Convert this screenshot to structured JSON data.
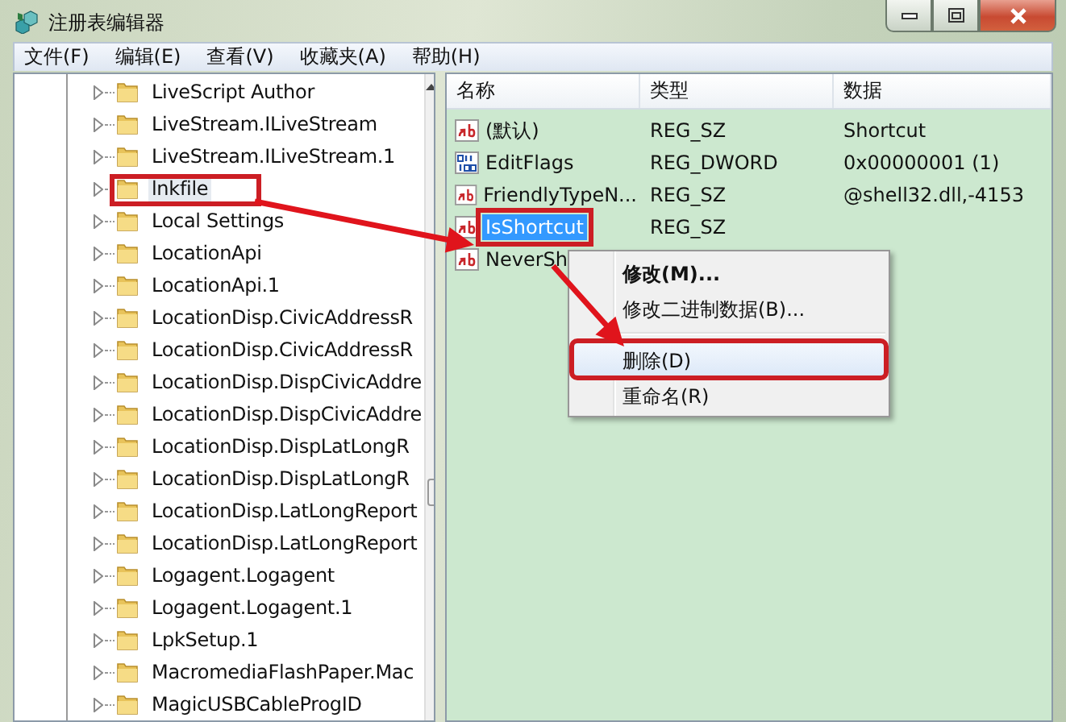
{
  "window": {
    "title": "注册表编辑器"
  },
  "menu": [
    "文件(F)",
    "编辑(E)",
    "查看(V)",
    "收藏夹(A)",
    "帮助(H)"
  ],
  "tree": {
    "items": [
      {
        "label": "LiveScript Author",
        "selected": false,
        "annotated": false
      },
      {
        "label": "LiveStream.ILiveStream",
        "selected": false,
        "annotated": false
      },
      {
        "label": "LiveStream.ILiveStream.1",
        "selected": false,
        "annotated": false
      },
      {
        "label": "lnkfile",
        "selected": true,
        "annotated": true
      },
      {
        "label": "Local Settings",
        "selected": false,
        "annotated": false
      },
      {
        "label": "LocationApi",
        "selected": false,
        "annotated": false
      },
      {
        "label": "LocationApi.1",
        "selected": false,
        "annotated": false
      },
      {
        "label": "LocationDisp.CivicAddressR",
        "selected": false,
        "annotated": false
      },
      {
        "label": "LocationDisp.CivicAddressR",
        "selected": false,
        "annotated": false
      },
      {
        "label": "LocationDisp.DispCivicAddre",
        "selected": false,
        "annotated": false
      },
      {
        "label": "LocationDisp.DispCivicAddre",
        "selected": false,
        "annotated": false
      },
      {
        "label": "LocationDisp.DispLatLongR",
        "selected": false,
        "annotated": false
      },
      {
        "label": "LocationDisp.DispLatLongR",
        "selected": false,
        "annotated": false
      },
      {
        "label": "LocationDisp.LatLongReport",
        "selected": false,
        "annotated": false
      },
      {
        "label": "LocationDisp.LatLongReport",
        "selected": false,
        "annotated": false
      },
      {
        "label": "Logagent.Logagent",
        "selected": false,
        "annotated": false
      },
      {
        "label": "Logagent.Logagent.1",
        "selected": false,
        "annotated": false
      },
      {
        "label": "LpkSetup.1",
        "selected": false,
        "annotated": false
      },
      {
        "label": "MacromediaFlashPaper.Mac",
        "selected": false,
        "annotated": false
      },
      {
        "label": "MagicUSBCableProgID",
        "selected": false,
        "annotated": false
      }
    ]
  },
  "values": {
    "columns": [
      "名称",
      "类型",
      "数据"
    ],
    "rows": [
      {
        "kind": "string",
        "name": "(默认)",
        "type": "REG_SZ",
        "data": "Shortcut",
        "selected": false,
        "annotated": false
      },
      {
        "kind": "binary",
        "name": "EditFlags",
        "type": "REG_DWORD",
        "data": "0x00000001 (1)",
        "selected": false,
        "annotated": false
      },
      {
        "kind": "string",
        "name": "FriendlyTypeN...",
        "type": "REG_SZ",
        "data": "@shell32.dll,-4153",
        "selected": false,
        "annotated": false
      },
      {
        "kind": "string",
        "name": "IsShortcut",
        "type": "REG_SZ",
        "selected": true,
        "annotated": true
      },
      {
        "kind": "string",
        "name": "NeverSh",
        "selected": false,
        "annotated": false
      }
    ]
  },
  "context_menu": {
    "items": [
      {
        "kind": "item",
        "label": "修改(M)...",
        "bold": true,
        "hovered": false,
        "annotated": false
      },
      {
        "kind": "item",
        "label": "修改二进制数据(B)...",
        "bold": false,
        "hovered": false,
        "annotated": false
      },
      {
        "kind": "separator"
      },
      {
        "kind": "item",
        "label": "删除(D)",
        "bold": false,
        "hovered": true,
        "annotated": true
      },
      {
        "kind": "item",
        "label": "重命名(R)",
        "bold": false,
        "hovered": false,
        "annotated": false
      }
    ]
  }
}
